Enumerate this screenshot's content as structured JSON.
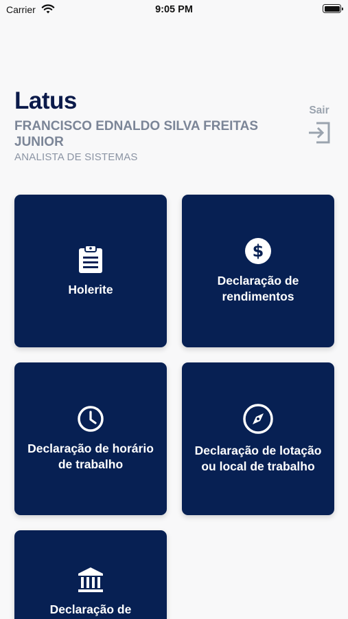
{
  "status_bar": {
    "carrier": "Carrier",
    "time": "9:05 PM",
    "wifi_icon": "wifi-icon",
    "battery_icon": "battery-icon"
  },
  "header": {
    "app_title": "Latus",
    "user_name": "FRANCISCO EDNALDO SILVA FREITAS JUNIOR",
    "user_role": "ANALISTA DE SISTEMAS"
  },
  "logout": {
    "label": "Sair",
    "icon": "logout-icon"
  },
  "colors": {
    "card_background": "#072053",
    "title": "#0b1a4a",
    "subtle_text": "#7b8597",
    "page_background": "#f8f8f9"
  },
  "menu": [
    {
      "label": "Holerite",
      "icon": "clipboard-icon"
    },
    {
      "label": "Declaração de rendimentos",
      "icon": "dollar-icon"
    },
    {
      "label": "Declaração de horário de trabalho",
      "icon": "clock-icon"
    },
    {
      "label": "Declaração de lotação ou local de trabalho",
      "icon": "compass-icon"
    },
    {
      "label": "Declaração de",
      "icon": "bank-icon"
    }
  ]
}
